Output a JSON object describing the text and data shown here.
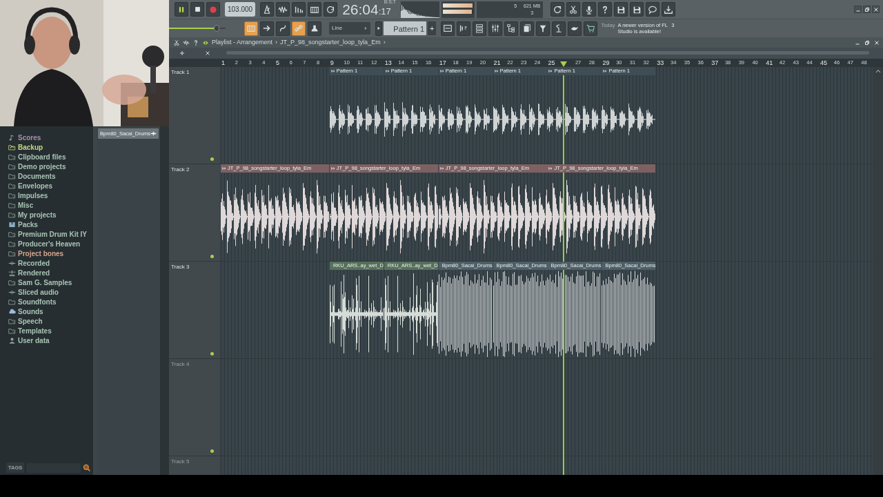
{
  "transport": {
    "playing": true
  },
  "tempo": "103.000",
  "time": {
    "main": "26:04",
    "sub": ":17",
    "format": "B:S:T"
  },
  "output_meter": [
    {
      "level": 0.97
    },
    {
      "level": 0.95
    }
  ],
  "cpu": {
    "value": "5",
    "memory": "621 MB",
    "polyphony": "3"
  },
  "master_volume": {
    "level": 0.84
  },
  "tool_toggles": [
    {
      "on": true
    },
    {
      "on": false
    },
    {
      "on": false
    },
    {
      "on": true
    },
    {
      "on": false
    }
  ],
  "snap": "Line",
  "pattern": {
    "name": "Pattern 1",
    "add": "+"
  },
  "news": {
    "date": "Today",
    "text": "A newer version of FL Studio is available!",
    "count": "3"
  },
  "browser": {
    "items": [
      {
        "label": "Scores",
        "kind": "note",
        "color": "#a88fae"
      },
      {
        "label": "Backup",
        "kind": "backup",
        "color": "#c9d97e"
      },
      {
        "label": "Clipboard files",
        "kind": "folder",
        "color": "#a9c4b5"
      },
      {
        "label": "Demo projects",
        "kind": "folder",
        "color": "#a9c4b5"
      },
      {
        "label": "Documents",
        "kind": "folder",
        "color": "#a9c4b5"
      },
      {
        "label": "Envelopes",
        "kind": "folder",
        "color": "#a9c4b5"
      },
      {
        "label": "Impulses",
        "kind": "folder",
        "color": "#a9c4b5"
      },
      {
        "label": "Misc",
        "kind": "plain",
        "color": "#a9c4b5"
      },
      {
        "label": "My projects",
        "kind": "folder",
        "color": "#a9c4b5"
      },
      {
        "label": "Packs",
        "kind": "packs",
        "color": "#a9c4b5"
      },
      {
        "label": "Premium Drum Kit IY",
        "kind": "folder",
        "color": "#a9c4b5"
      },
      {
        "label": "Producer's Heaven",
        "kind": "folder",
        "color": "#a9c4b5"
      },
      {
        "label": "Project bones",
        "kind": "folder",
        "color": "#d6a58f"
      },
      {
        "label": "Recorded",
        "kind": "plus",
        "color": "#a9c4b5"
      },
      {
        "label": "Rendered",
        "kind": "rendered",
        "color": "#a9c4b5"
      },
      {
        "label": "Sam G. Samples",
        "kind": "folder",
        "color": "#a9c4b5"
      },
      {
        "label": "Sliced audio",
        "kind": "plus",
        "color": "#a9c4b5"
      },
      {
        "label": "Soundfonts",
        "kind": "plain",
        "color": "#a9c4b5"
      },
      {
        "label": "Sounds",
        "kind": "cloud",
        "color": "#a9c4b5"
      },
      {
        "label": "Speech",
        "kind": "folder",
        "color": "#a9c4b5"
      },
      {
        "label": "Templates",
        "kind": "folder",
        "color": "#a9c4b5"
      },
      {
        "label": "User data",
        "kind": "user",
        "color": "#a9c4b5"
      }
    ],
    "clip_source": "Bpm80_Sacai_Drums",
    "tags_label": "TAGS"
  },
  "playlist": {
    "crumbs": [
      {
        "label": "Playlist - Arrangement",
        "sep": "›"
      },
      {
        "label": "JT_P_98_songstarter_loop_tyla_Em",
        "sep": "›"
      }
    ],
    "ruler": [
      "1",
      "2",
      "3",
      "4",
      "5",
      "6",
      "7",
      "8",
      "9",
      "10",
      "11",
      "12",
      "13",
      "14",
      "15",
      "16",
      "17",
      "18",
      "19",
      "20",
      "21",
      "22",
      "23",
      "24",
      "25"
    ],
    "ruler_past_playhead": [
      "27",
      "28",
      "29",
      "30",
      "31",
      "32",
      "33",
      "34",
      "35",
      "36",
      "37",
      "38",
      "39",
      "40",
      "41",
      "42",
      "43",
      "44",
      "45",
      "46",
      "47",
      "48"
    ],
    "playhead": {
      "level": 0.526
    },
    "tracks": [
      {
        "name": "Track 1",
        "enabled": true,
        "lead_in": true,
        "clips": [
          {
            "label": "Pattern 1",
            "kind": "pattern",
            "color": "#3f4e54"
          },
          {
            "label": "Pattern 1",
            "kind": "pattern",
            "color": "#3f4e54"
          },
          {
            "label": "Pattern 1",
            "kind": "pattern",
            "color": "#3f4e54"
          },
          {
            "label": "Pattern 1",
            "kind": "pattern",
            "color": "#3f4e54"
          },
          {
            "label": "Pattern 1",
            "kind": "pattern",
            "color": "#3f4e54"
          },
          {
            "label": "Pattern 1",
            "kind": "pattern",
            "color": "#3f4e54"
          }
        ]
      },
      {
        "name": "Track 2",
        "enabled": true,
        "clips": [
          {
            "label": "JT_P_98_songstarter_loop_tyla_Em",
            "kind": "loop",
            "long": true,
            "color": "#7d6162"
          },
          {
            "label": "JT_P_98_songstarter_loop_tyla_Em",
            "kind": "loop",
            "long": true,
            "color": "#7d6162"
          },
          {
            "label": "JT_P_98_songstarter_loop_tyla_Em",
            "kind": "loop",
            "long": true,
            "color": "#7d6162"
          },
          {
            "label": "JT_P_98_songstarter_loop_tyla_Em",
            "kind": "loop",
            "long": true,
            "color": "#7d6162"
          }
        ]
      },
      {
        "name": "Track 3",
        "enabled": true,
        "lead_in": true,
        "clips": [
          {
            "label": "RKU_ARS..ay_wet_D",
            "kind": "vocal",
            "color": "#56705a"
          },
          {
            "label": "RKU_ARS..ay_wet_D",
            "kind": "vocal",
            "color": "#56705a"
          },
          {
            "label": "Bpm80_Sacai_Drums",
            "kind": "drums",
            "color": "#4d5e66"
          },
          {
            "label": "Bpm80_Sacai_Drums",
            "kind": "drums",
            "color": "#4d5e66"
          },
          {
            "label": "Bpm80_Sacai_Drums",
            "kind": "drums",
            "color": "#4d5e66"
          },
          {
            "label": "Bpm80_Sacai_Drums",
            "kind": "drums",
            "color": "#4d5e66"
          }
        ]
      },
      {
        "name": "Track 4",
        "enabled": true
      },
      {
        "name": "Track 5"
      }
    ]
  }
}
